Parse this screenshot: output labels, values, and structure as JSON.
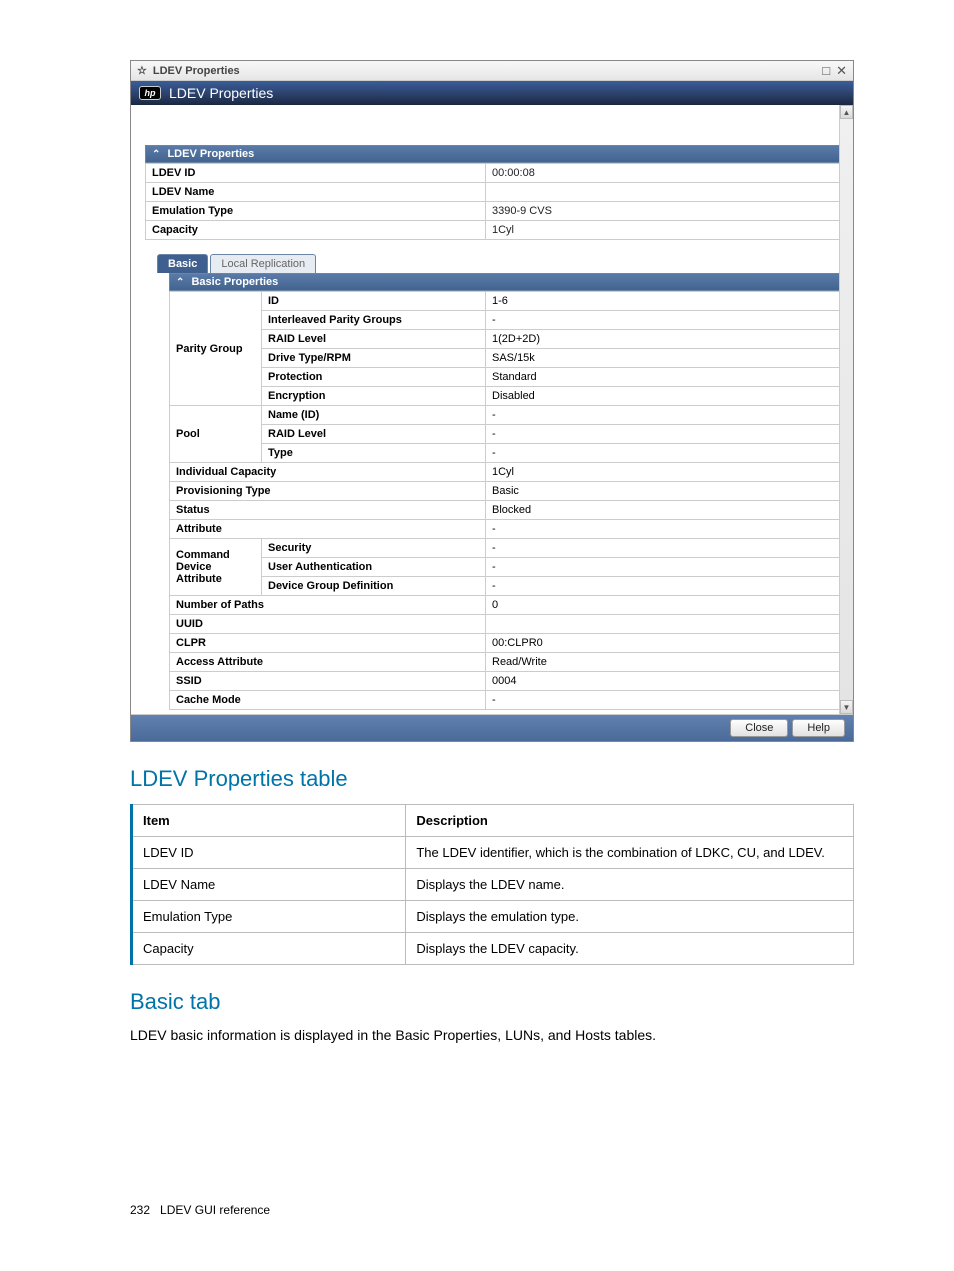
{
  "window": {
    "title": "LDEV Properties",
    "header_title": "LDEV Properties",
    "buttons": {
      "close": "Close",
      "help": "Help"
    }
  },
  "ldev_props": {
    "section_title": "LDEV Properties",
    "rows": [
      {
        "label": "LDEV ID",
        "value": "00:00:08"
      },
      {
        "label": "LDEV Name",
        "value": ""
      },
      {
        "label": "Emulation Type",
        "value": "3390-9 CVS"
      },
      {
        "label": "Capacity",
        "value": "1Cyl"
      }
    ]
  },
  "tabs": {
    "basic": "Basic",
    "local_replication": "Local Replication"
  },
  "basic_props": {
    "section_title": "Basic Properties",
    "parity_group": {
      "label": "Parity Group",
      "rows": [
        {
          "sub": "ID",
          "value": "1-6"
        },
        {
          "sub": "Interleaved Parity Groups",
          "value": "-"
        },
        {
          "sub": "RAID Level",
          "value": "1(2D+2D)"
        },
        {
          "sub": "Drive Type/RPM",
          "value": "SAS/15k"
        },
        {
          "sub": "Protection",
          "value": "Standard"
        },
        {
          "sub": "Encryption",
          "value": "Disabled"
        }
      ]
    },
    "pool": {
      "label": "Pool",
      "rows": [
        {
          "sub": "Name (ID)",
          "value": "-"
        },
        {
          "sub": "RAID Level",
          "value": "-"
        },
        {
          "sub": "Type",
          "value": "-"
        }
      ]
    },
    "singles1": [
      {
        "label": "Individual Capacity",
        "value": "1Cyl"
      },
      {
        "label": "Provisioning Type",
        "value": "Basic"
      },
      {
        "label": "Status",
        "value": "Blocked"
      },
      {
        "label": "Attribute",
        "value": "-"
      }
    ],
    "command_device": {
      "label": "Command Device Attribute",
      "rows": [
        {
          "sub": "Security",
          "value": "-"
        },
        {
          "sub": "User Authentication",
          "value": "-"
        },
        {
          "sub": "Device Group Definition",
          "value": "-"
        }
      ]
    },
    "singles2": [
      {
        "label": "Number of Paths",
        "value": "0"
      },
      {
        "label": "UUID",
        "value": ""
      },
      {
        "label": "CLPR",
        "value": "00:CLPR0"
      },
      {
        "label": "Access Attribute",
        "value": "Read/Write"
      },
      {
        "label": "SSID",
        "value": "0004"
      },
      {
        "label": "Cache Mode",
        "value": "-"
      }
    ]
  },
  "doc": {
    "h_ldev_table": "LDEV Properties table",
    "table_headers": {
      "item": "Item",
      "desc": "Description"
    },
    "ldev_table_rows": [
      {
        "item": "LDEV ID",
        "desc": "The LDEV identifier, which is the combination of LDKC, CU, and LDEV."
      },
      {
        "item": "LDEV Name",
        "desc": "Displays the LDEV name."
      },
      {
        "item": "Emulation Type",
        "desc": "Displays the emulation type."
      },
      {
        "item": "Capacity",
        "desc": "Displays the LDEV capacity."
      }
    ],
    "h_basic_tab": "Basic tab",
    "basic_tab_text": "LDEV basic information is displayed in the Basic Properties, LUNs, and Hosts tables.",
    "footer": {
      "page": "232",
      "title": "LDEV GUI reference"
    }
  }
}
